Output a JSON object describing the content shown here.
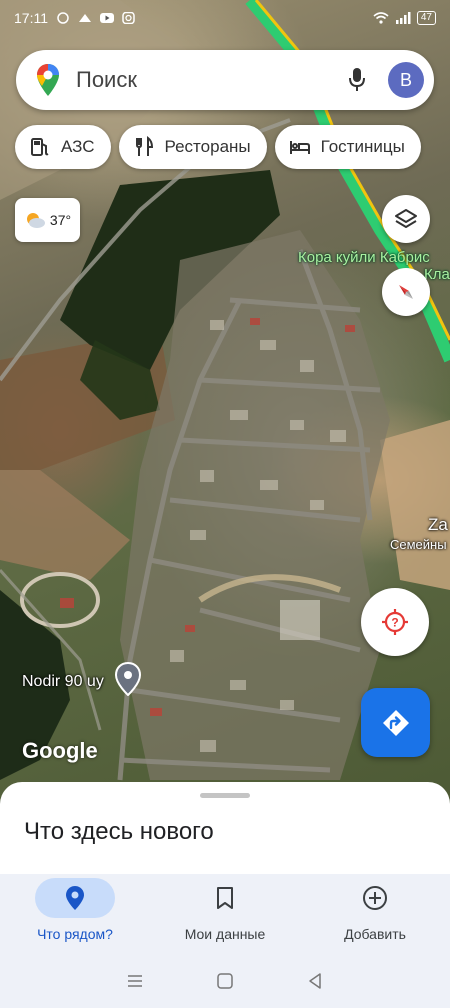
{
  "status_bar": {
    "time": "17:11",
    "battery": "47"
  },
  "search": {
    "placeholder": "Поиск",
    "avatar_letter": "B"
  },
  "chips": [
    {
      "label": "АЗС",
      "icon": "gas-station-icon"
    },
    {
      "label": "Рестораны",
      "icon": "restaurant-icon"
    },
    {
      "label": "Гостиницы",
      "icon": "hotel-icon"
    }
  ],
  "weather": {
    "temp": "37°",
    "icon": "partly-sunny-icon"
  },
  "map": {
    "labels": {
      "road_1": "Кора куйли Кабрис",
      "road_2": "Кла",
      "place_1": "Za",
      "place_2": "Семейны",
      "pin_label": "Nodir 90 uy"
    },
    "attribution": "Google"
  },
  "sheet": {
    "title": "Что здесь нового"
  },
  "bottom_nav": [
    {
      "label": "Что рядом?",
      "icon": "location-pin-icon",
      "active": true
    },
    {
      "label": "Мои данные",
      "icon": "bookmark-icon",
      "active": false
    },
    {
      "label": "Добавить",
      "icon": "add-circle-icon",
      "active": false
    }
  ],
  "colors": {
    "accent": "#1a73e8",
    "road_green": "#2ecc71",
    "road_yellow": "#f1c40f",
    "nav_bg": "#eef1f8"
  }
}
